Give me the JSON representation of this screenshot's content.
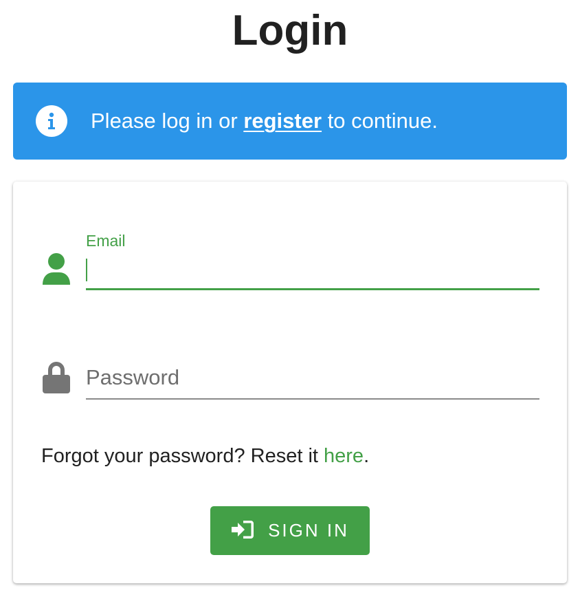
{
  "page": {
    "title": "Login"
  },
  "alert": {
    "icon": "info-icon",
    "text_before": "Please log in or ",
    "link_label": "register",
    "text_after": " to continue.",
    "color": "#2b95e9"
  },
  "form": {
    "email": {
      "label": "Email",
      "value": "",
      "icon": "user-icon"
    },
    "password": {
      "placeholder": "Password",
      "value": "",
      "icon": "lock-icon"
    },
    "forgot": {
      "text_before": "Forgot your password? Reset it ",
      "link_label": "here",
      "text_after": "."
    },
    "submit": {
      "label": "SIGN IN",
      "icon": "sign-in-icon"
    }
  },
  "colors": {
    "accent": "#43a047",
    "alert": "#2b95e9",
    "text": "#212121",
    "muted_icon": "#757575"
  }
}
